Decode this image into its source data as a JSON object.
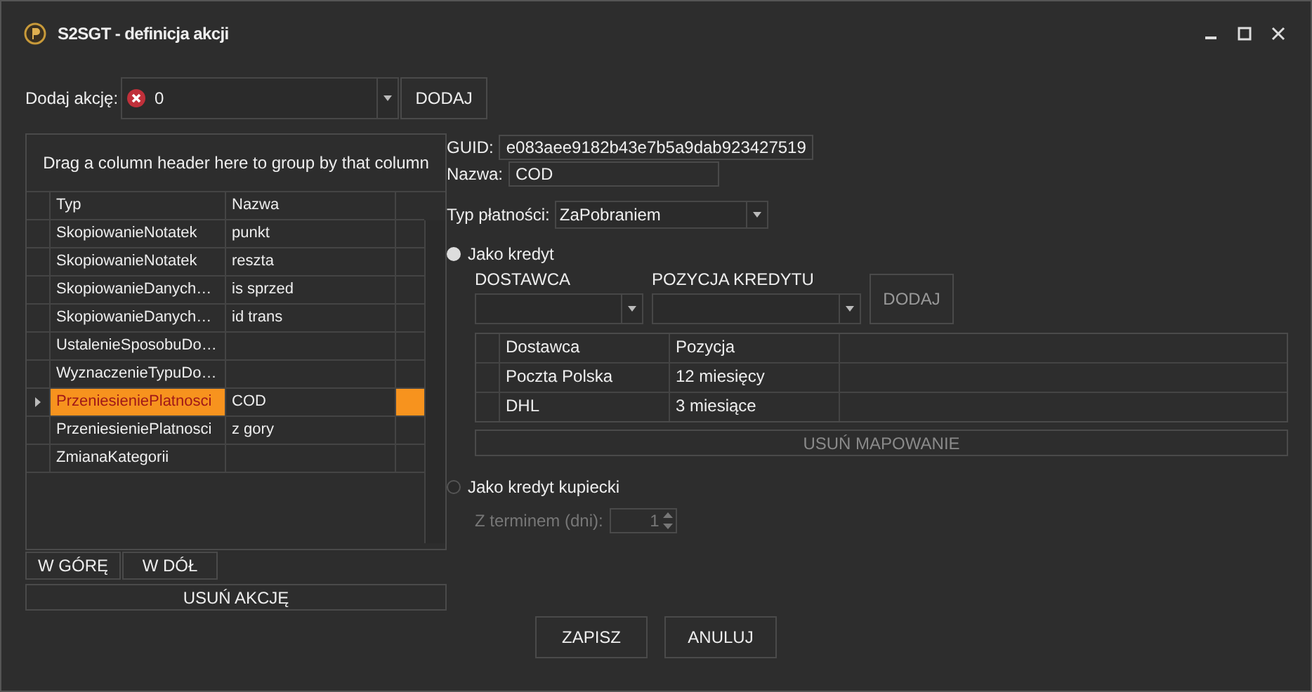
{
  "window": {
    "title": "S2SGT - definicja akcji"
  },
  "add_action": {
    "label": "Dodaj akcję:",
    "value": "0",
    "button": "DODAJ"
  },
  "actions_grid": {
    "group_hint": "Drag a column header here to group by that column",
    "columns": [
      "Typ",
      "Nazwa"
    ],
    "rows": [
      {
        "typ": "SkopiowanieNotatek",
        "nazwa": "punkt",
        "selected": false
      },
      {
        "typ": "SkopiowanieNotatek",
        "nazwa": "reszta",
        "selected": false
      },
      {
        "typ": "SkopiowanieDanych…",
        "nazwa": "is sprzed",
        "selected": false
      },
      {
        "typ": "SkopiowanieDanych…",
        "nazwa": "id trans",
        "selected": false
      },
      {
        "typ": "UstalenieSposobuDo…",
        "nazwa": "",
        "selected": false
      },
      {
        "typ": "WyznaczenieTypuDo…",
        "nazwa": "",
        "selected": false
      },
      {
        "typ": "PrzeniesieniePlatnosci",
        "nazwa": "COD",
        "selected": true
      },
      {
        "typ": "PrzeniesieniePlatnosci",
        "nazwa": "z gory",
        "selected": false
      },
      {
        "typ": "ZmianaKategorii",
        "nazwa": "",
        "selected": false
      }
    ]
  },
  "left_buttons": [
    "W GÓRĘ",
    "W DÓŁ"
  ],
  "remove_action": "USUŃ AKCJĘ",
  "guid": {
    "label": "GUID:",
    "value": "e083aee9182b43e7b5a9dab923427519"
  },
  "name": {
    "label": "Nazwa:",
    "value": "COD"
  },
  "payment_type": {
    "label": "Typ płatności:",
    "value": "ZaPobraniem"
  },
  "credit": {
    "label": "Jako kredyt",
    "selected": true,
    "supplier_label": "DOSTAWCA",
    "position_label": "POZYCJA KREDYTU",
    "add_button": "DODAJ",
    "columns": [
      "Dostawca",
      "Pozycja"
    ],
    "rows": [
      {
        "dostawca": "Poczta Polska",
        "pozycja": "12 miesięcy"
      },
      {
        "dostawca": "DHL",
        "pozycja": "3 miesiące"
      }
    ],
    "remove_mapping": {
      "label": "USUŃ MAPOWANIE",
      "disabled": true
    }
  },
  "merchant_credit": {
    "label": "Jako kredyt kupiecki",
    "selected": false,
    "term_label": "Z terminem (dni):",
    "term_value": "1",
    "disabled": true
  },
  "footer_buttons": [
    "ZAPISZ",
    "ANULUJ"
  ]
}
